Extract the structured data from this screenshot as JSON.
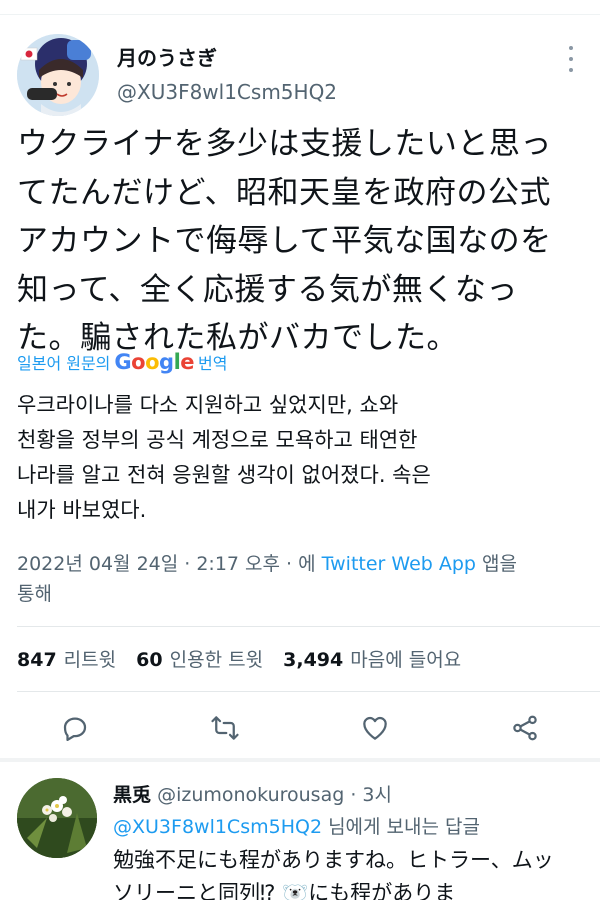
{
  "tweet": {
    "author_name": "月のうさぎ",
    "author_handle": "@XU3F8wl1Csm5HQ2",
    "text_lines": [
      "ウクライナを多少は支援したいと思っ",
      "てたんだけど、昭和天皇を政府の公式",
      "アカウントで侮辱して平気な国なのを",
      "知って、全く応援する気が無くなっ",
      "た。騙された私がバカでした。"
    ],
    "translate_prefix": "일본어 원문의",
    "translate_brand": "Google",
    "translate_suffix": "번역",
    "translated_lines": [
      "우크라이나를 다소 지원하고 싶었지만, 쇼와",
      "천황을 정부의 공식 계정으로 모욕하고 태연한",
      "나라를 알고 전혀 응원할 생각이 없어졌다. 속은",
      "내가 바보였다."
    ],
    "date_time": "2022년 04월 24일 · 2:17 오후 · 에",
    "source": "Twitter Web App",
    "via_suffix": "앱을",
    "via_line2": "통해",
    "retweets": "847",
    "retweets_label": "리트윗",
    "quotes": "60",
    "quotes_label": "인용한 트윗",
    "likes": "3,494",
    "likes_label": "마음에 들어요"
  },
  "icons": {
    "more": "more-vertical-icon",
    "reply": "reply-icon",
    "retweet": "retweet-icon",
    "like": "heart-icon",
    "share": "share-icon"
  },
  "reply": {
    "name": "黒兎",
    "handle_time": "@izumonokurousag · 3시",
    "mention": "@XU3F8wl1Csm5HQ2",
    "reply_to_suffix": "님에게 보내는 답글",
    "text_lines": [
      "勉強不足にも程がありますね。ヒトラー、ムッ",
      "ソリーニと同列⁉ 🐻‍❄️にも程がありま"
    ]
  },
  "colors": {
    "accent": "#1d9bf0",
    "secondary_text": "#536471",
    "primary_text": "#0f1419"
  }
}
